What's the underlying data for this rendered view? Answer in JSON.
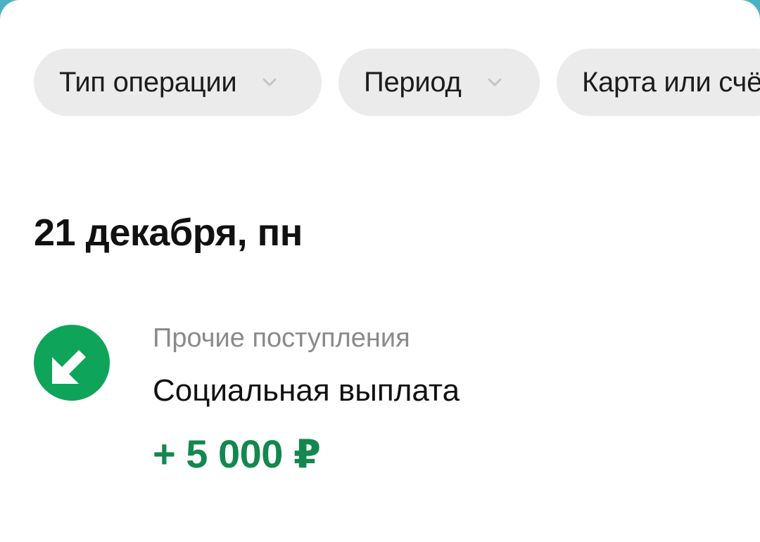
{
  "filters": [
    {
      "label": "Тип операции",
      "icon": "chevron-down-icon"
    },
    {
      "label": "Период",
      "icon": "chevron-down-icon"
    },
    {
      "label": "Карта или счёт",
      "icon": "chevron-down-icon"
    }
  ],
  "day": {
    "date_label": "21 декабря, пн"
  },
  "transaction": {
    "category": "Прочие поступления",
    "title": "Социальная выплата",
    "amount": "+ 5 000 ₽",
    "icon": "incoming-arrow-icon",
    "icon_color": "#0ea45a",
    "amount_color": "#14874f"
  },
  "colors": {
    "chip_background": "#ebebeb",
    "app_accent": "#49b3c3"
  }
}
